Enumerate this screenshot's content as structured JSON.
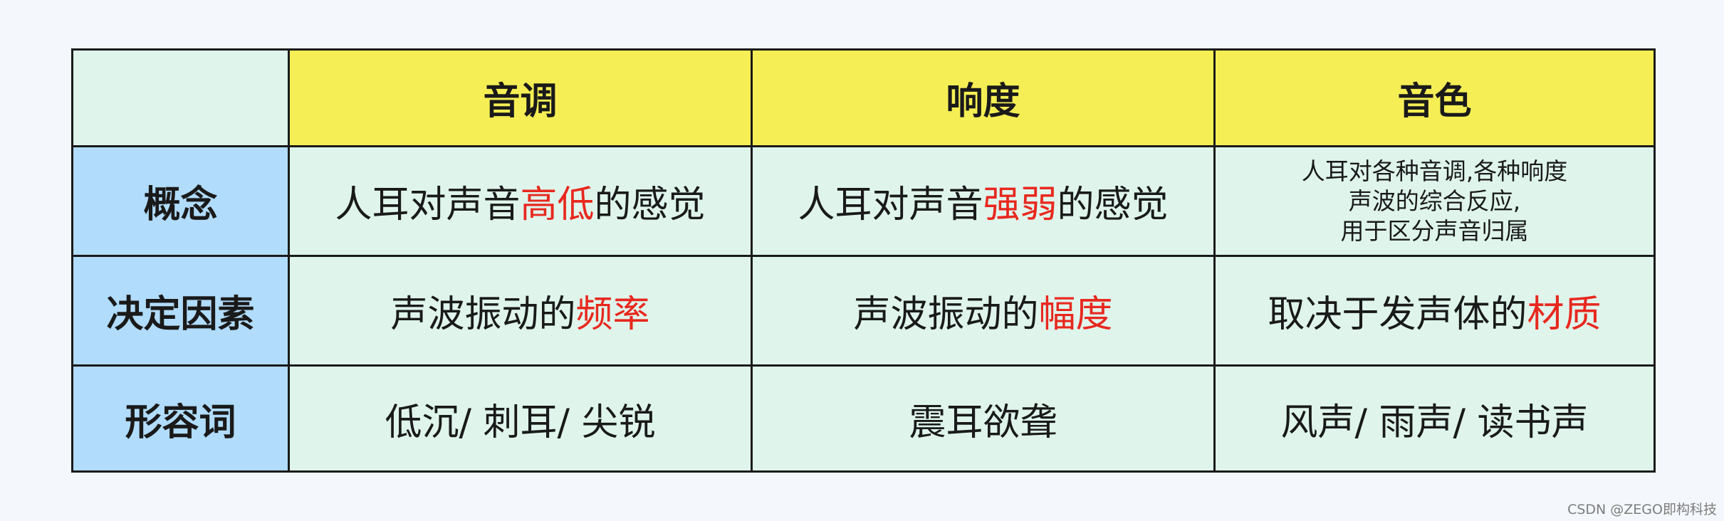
{
  "columns": [
    "音调",
    "响度",
    "音色"
  ],
  "rows": [
    {
      "label": "概念",
      "cells": [
        {
          "pre": "人耳对声音",
          "hl": "高低",
          "post": "的感觉"
        },
        {
          "pre": "人耳对声音",
          "hl": "强弱",
          "post": "的感觉"
        }
      ],
      "timbre_lines": [
        "人耳对各种音调,各种响度",
        "声波的综合反应,",
        "用于区分声音归属"
      ]
    },
    {
      "label": "决定因素",
      "cells": [
        {
          "pre": "声波振动的",
          "hl": "频率",
          "post": ""
        },
        {
          "pre": "声波振动的",
          "hl": "幅度",
          "post": ""
        },
        {
          "pre": "取决于发声体的",
          "hl": "材质",
          "post": ""
        }
      ]
    },
    {
      "label": "形容词",
      "cells": [
        "低沉/ 刺耳/ 尖锐",
        "震耳欲聋",
        "风声/ 雨声/ 读书声"
      ]
    }
  ],
  "watermark": "CSDN @ZEGO即构科技",
  "colors": {
    "header_yellow": "#f5ef55",
    "row_header_blue": "#b1dcfc",
    "cell_mint": "#dff5ec",
    "highlight_red": "#e8281f"
  }
}
